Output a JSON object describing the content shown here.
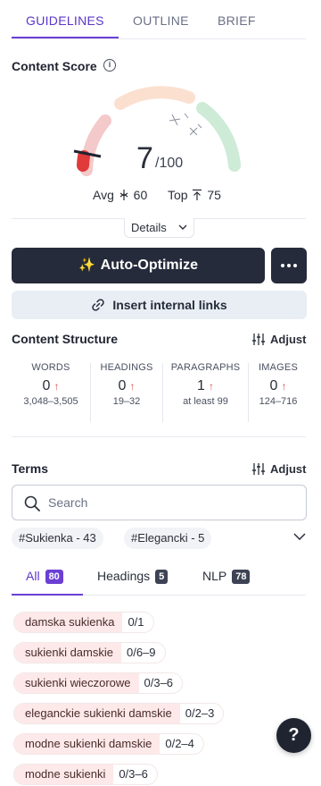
{
  "tabs": [
    {
      "label": "GUIDELINES",
      "active": true
    },
    {
      "label": "OUTLINE",
      "active": false
    },
    {
      "label": "BRIEF",
      "active": false
    }
  ],
  "content_score": {
    "title": "Content Score",
    "info_icon": "info-icon",
    "score": "7",
    "max": "/100",
    "avg_label": "Avg",
    "avg_value": "60",
    "top_label": "Top",
    "top_value": "75",
    "details_label": "Details",
    "gauge_fraction": 0.07,
    "colors": {
      "low": "#f4c9c9",
      "mid": "#fbe0d0",
      "high": "#cdebd6",
      "needle": "#e03a3a"
    }
  },
  "actions": {
    "auto_optimize_label": "Auto-Optimize",
    "auto_optimize_icon": "sparkles-icon",
    "more_icon": "more-icon",
    "insert_links_label": "Insert internal links",
    "insert_links_icon": "link-icon"
  },
  "structure": {
    "title": "Content Structure",
    "adjust_label": "Adjust",
    "stats": [
      {
        "label": "WORDS",
        "value": "0",
        "range": "3,048–3,505"
      },
      {
        "label": "HEADINGS",
        "value": "0",
        "range": "19–32"
      },
      {
        "label": "PARAGRAPHS",
        "value": "1",
        "range": "at least 99"
      },
      {
        "label": "IMAGES",
        "value": "0",
        "range": "124–716"
      }
    ],
    "arrow": "↑"
  },
  "terms": {
    "title": "Terms",
    "adjust_label": "Adjust",
    "search_placeholder": "Search",
    "tags": [
      "#Sukienka - 43",
      "#Elegancki - 5"
    ],
    "filter_tabs": [
      {
        "label": "All",
        "count": "80",
        "active": true
      },
      {
        "label": "Headings",
        "count": "5",
        "active": false
      },
      {
        "label": "NLP",
        "count": "78",
        "active": false
      }
    ],
    "items": [
      {
        "name": "damska sukienka",
        "count": "0/1"
      },
      {
        "name": "sukienki damskie",
        "count": "0/6–9"
      },
      {
        "name": "sukienki wieczorowe",
        "count": "0/3–6"
      },
      {
        "name": "eleganckie sukienki damskie",
        "count": "0/2–3"
      },
      {
        "name": "modne sukienki damskie",
        "count": "0/2–4"
      },
      {
        "name": "modne sukienki",
        "count": "0/3–6"
      }
    ]
  },
  "help": {
    "label": "?"
  }
}
